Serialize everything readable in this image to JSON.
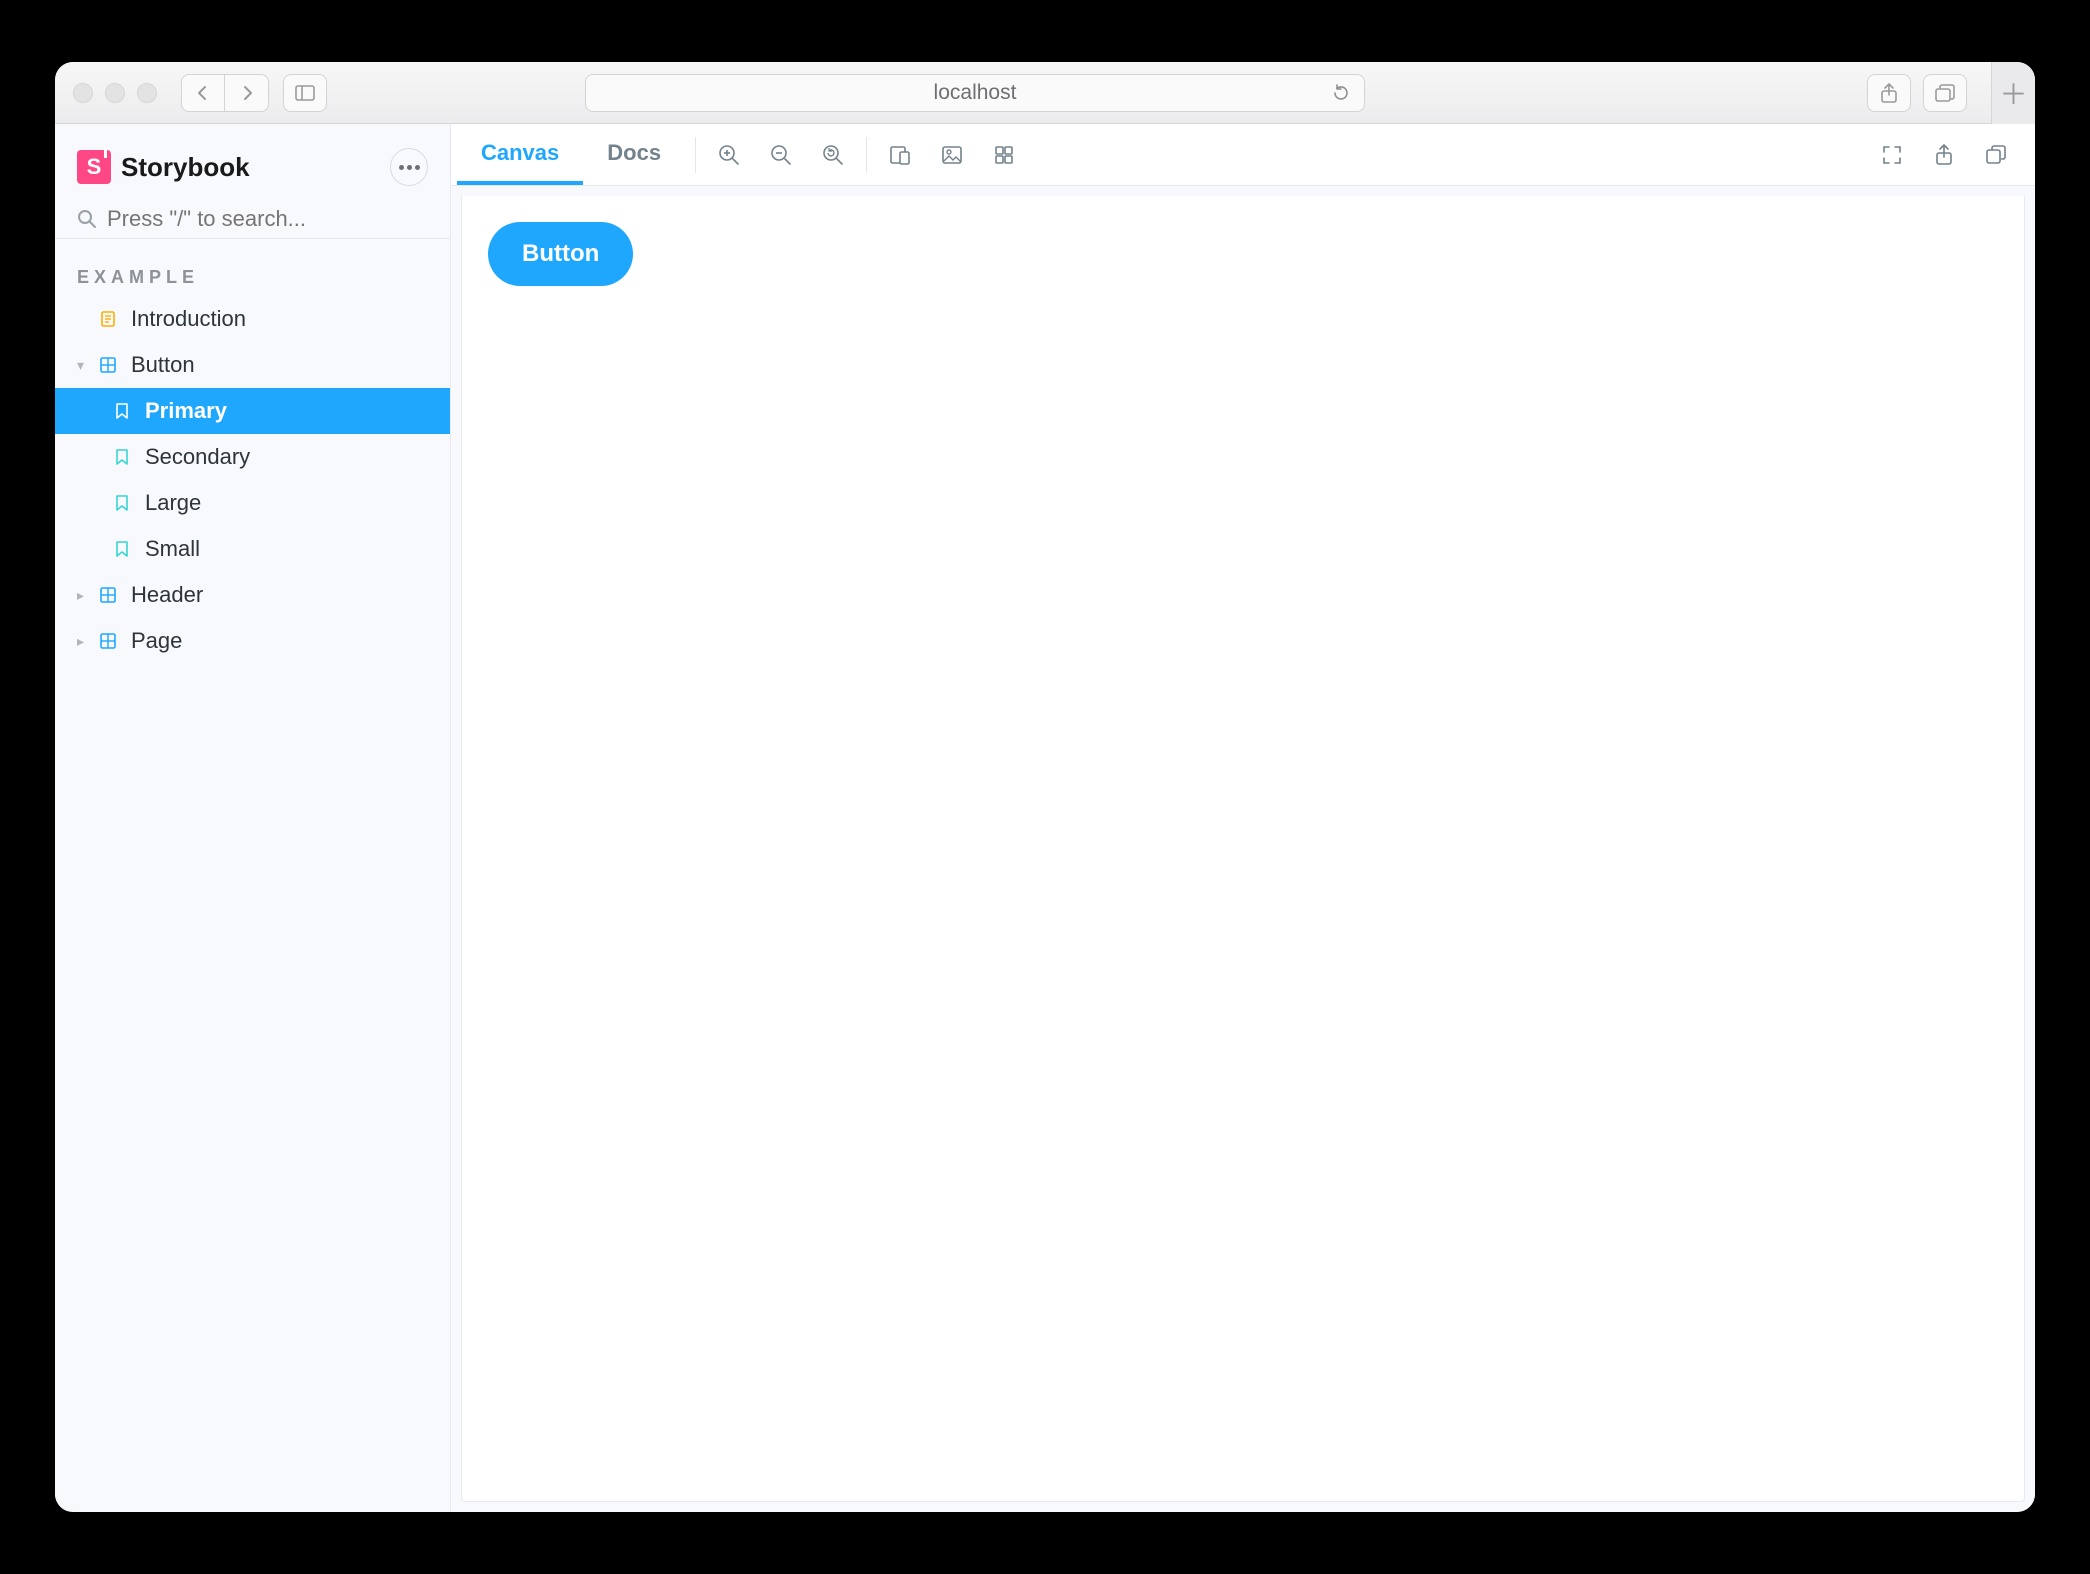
{
  "browser": {
    "address": "localhost"
  },
  "brand": {
    "badge_letter": "S",
    "name": "Storybook"
  },
  "search": {
    "placeholder": "Press \"/\" to search..."
  },
  "sidebar": {
    "section_label": "EXAMPLE",
    "items": {
      "introduction": "Introduction",
      "button": "Button",
      "header": "Header",
      "page": "Page"
    },
    "button_stories": {
      "primary": "Primary",
      "secondary": "Secondary",
      "large": "Large",
      "small": "Small"
    }
  },
  "tabs": {
    "canvas": "Canvas",
    "docs": "Docs"
  },
  "preview": {
    "button_label": "Button"
  },
  "colors": {
    "accent": "#1ea7fd",
    "brand_pink": "#ff4785",
    "story_teal": "#37d5d3",
    "doc_amber": "#ffae00"
  }
}
